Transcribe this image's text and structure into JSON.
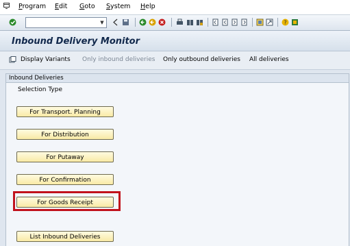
{
  "menu": {
    "items": [
      {
        "first": "P",
        "rest": "rogram"
      },
      {
        "first": "E",
        "rest": "dit"
      },
      {
        "first": "G",
        "rest": "oto"
      },
      {
        "first": "S",
        "rest": "ystem"
      },
      {
        "first": "H",
        "rest": "elp"
      }
    ]
  },
  "toolbar": {
    "command_field_value": "",
    "icons": [
      "enter-icon",
      "back-arrow-icon",
      "save-icon",
      "back-icon",
      "exit-icon",
      "cancel-icon",
      "print-icon",
      "find-icon",
      "find-next-icon",
      "first-page-icon",
      "previous-page-icon",
      "next-page-icon",
      "last-page-icon",
      "new-session-icon",
      "shortcut-icon",
      "help-icon",
      "layout-icon"
    ]
  },
  "title": "Inbound Delivery Monitor",
  "app_toolbar": {
    "display_variants": "Display Variants",
    "only_inbound": "Only inbound deliveries",
    "only_outbound": "Only outbound deliveries",
    "all_deliveries": "All deliveries"
  },
  "group": {
    "title": "Inbound Deliveries",
    "selection_label": "Selection Type",
    "buttons": [
      {
        "label": "For Transport. Planning"
      },
      {
        "label": "For Distribution"
      },
      {
        "label": "For Putaway"
      },
      {
        "label": "For Confirmation"
      },
      {
        "label": "For Goods Receipt",
        "highlighted": true
      },
      {
        "label": "List Inbound Deliveries"
      }
    ]
  },
  "colors": {
    "highlight": "#c1121c",
    "button_bg": "#f9eaa6",
    "title": "#11284b"
  }
}
